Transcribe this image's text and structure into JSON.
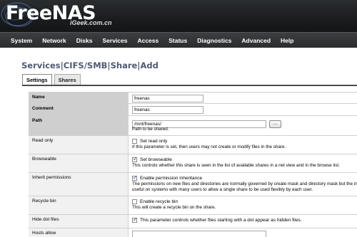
{
  "header": {
    "logo": "FreeNAS",
    "watermark": "iGeek.com.cn"
  },
  "nav": [
    "System",
    "Network",
    "Disks",
    "Services",
    "Access",
    "Status",
    "Diagnostics",
    "Advanced",
    "Help"
  ],
  "page_title": "Services|CIFS/SMB|Share|Add",
  "tabs": [
    {
      "label": "Settings",
      "active": true
    },
    {
      "label": "Shares",
      "active": false
    }
  ],
  "form": {
    "name": {
      "label": "Name",
      "value": "freenas"
    },
    "comment": {
      "label": "Comment",
      "value": "freenas"
    },
    "path": {
      "label": "Path",
      "value": "/mnt/freenas/",
      "button": "...",
      "hint": "Path to be shared."
    },
    "read_only": {
      "label": "Read only",
      "checked": false,
      "option": "Set read only",
      "hint": "If this parameter is set, then users may not create or modify files in the share."
    },
    "browseable": {
      "label": "Browseable",
      "checked": true,
      "option": "Set browseable",
      "hint": "This controls whether this share is seen in the list of available shares in a net view and in the browse list."
    },
    "inherit_permissions": {
      "label": "Inherit permissions",
      "checked": true,
      "option": "Enable permission inheritance",
      "hint": "The permissions on new files and directories are normally governed by create mask and directory mask but the inh",
      "hint2": "useful on systems with many users to allow a single share to be used flexibly by each user."
    },
    "recycle_bin": {
      "label": "Recycle bin",
      "checked": false,
      "option": "Enable recycle bin",
      "hint": "This will create a recycle bin on the share."
    },
    "hide_dot_files": {
      "label": "Hide dot files",
      "checked": true,
      "option": "This parameter controls whether files starting with a dot appear as hidden files."
    },
    "hosts_allow": {
      "label": "Hosts allow",
      "value": ""
    }
  },
  "colors": {
    "header_bg": "#1c1e20",
    "title": "#4f5a72",
    "required_label_bg": "#cfcfcf",
    "optional_label_bg": "#f1f1f1"
  }
}
